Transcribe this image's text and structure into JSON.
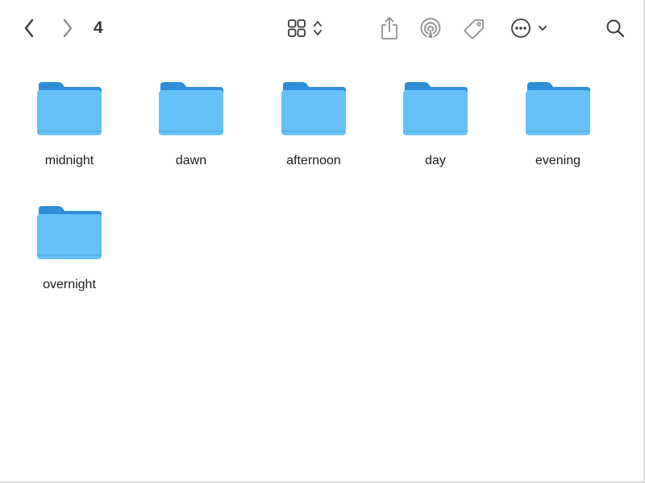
{
  "toolbar": {
    "folder_title": "4",
    "icons": {
      "back": "chevron-left-icon",
      "forward": "chevron-right-icon",
      "view": "grid-view-icon",
      "view_toggle": "chevron-up-down-icon",
      "share": "share-icon",
      "airdrop": "airdrop-icon",
      "tag": "tag-icon",
      "more": "ellipsis-circle-icon",
      "more_menu": "chevron-down-icon",
      "search": "search-icon"
    }
  },
  "folders": [
    {
      "name": "midnight"
    },
    {
      "name": "dawn"
    },
    {
      "name": "afternoon"
    },
    {
      "name": "day"
    },
    {
      "name": "evening"
    },
    {
      "name": "overnight"
    }
  ],
  "colors": {
    "folder_tab": "#2f8ed8",
    "folder_body": "#66c1f9",
    "icon_gray": "#8e8e93",
    "icon_dark": "#3a3a3a"
  }
}
